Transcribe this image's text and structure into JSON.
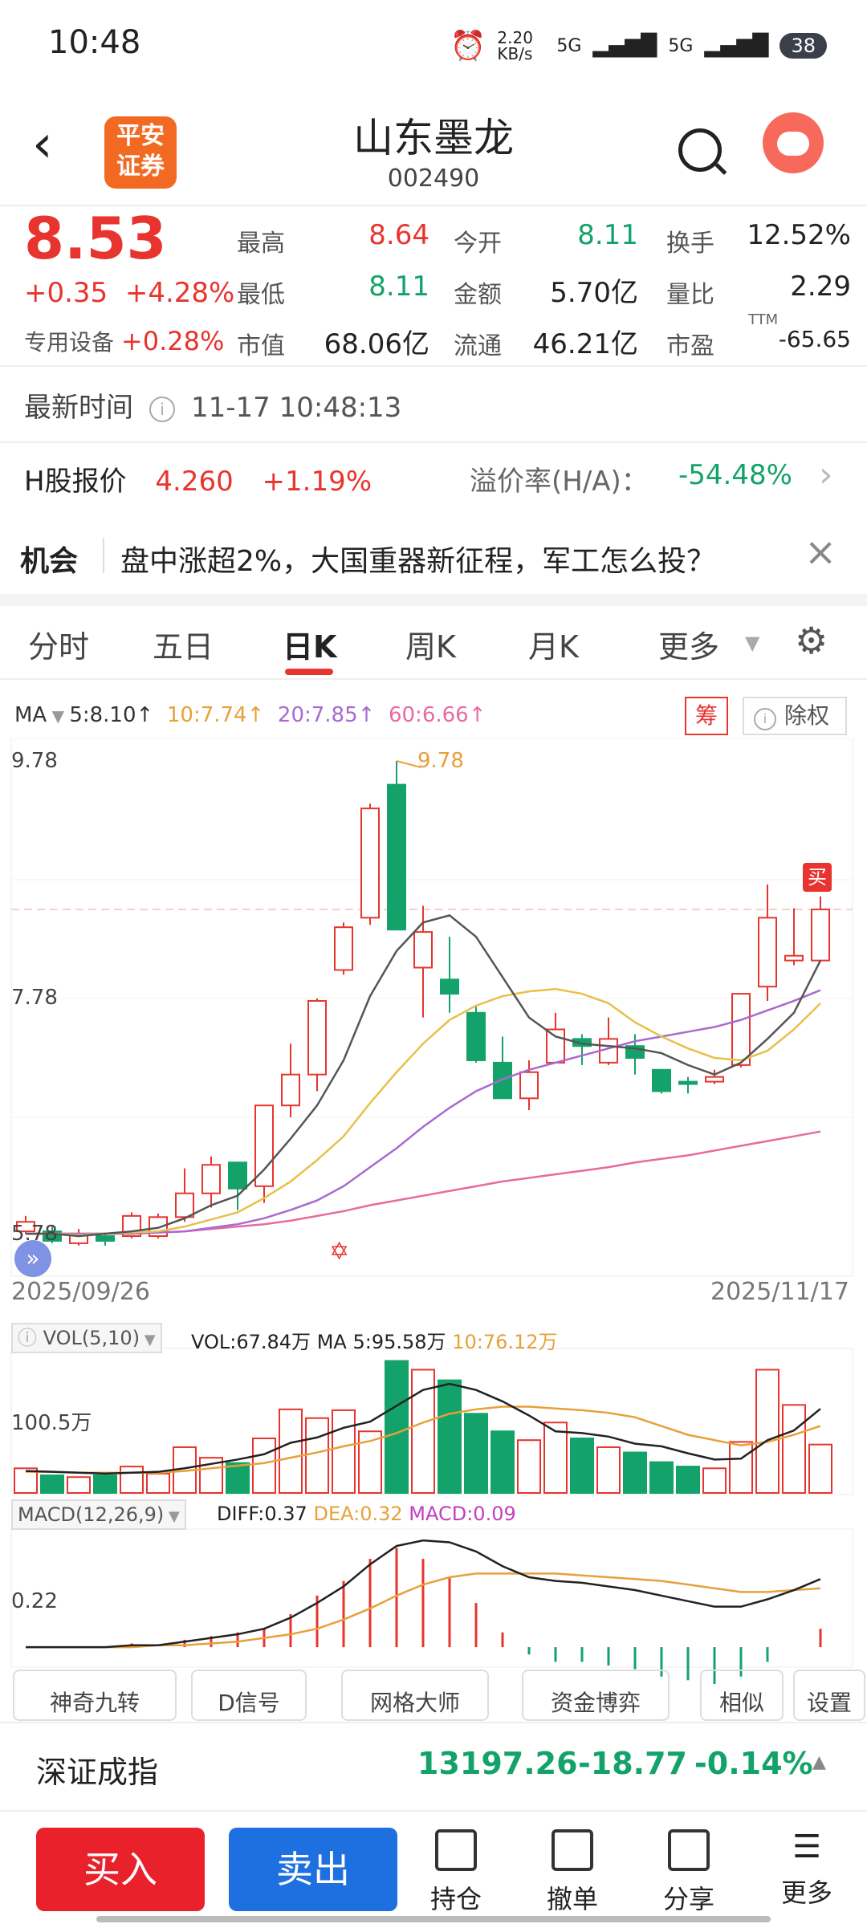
{
  "status": {
    "time": "10:48",
    "speed": "2.20 KB/s",
    "net1": "5G",
    "net2": "5G",
    "battery": "38"
  },
  "header": {
    "logo_text": "平安证券",
    "stock_name": "山东墨龙",
    "stock_code": "002490"
  },
  "quote": {
    "price": "8.53",
    "change": "+0.35",
    "change_pct": "+4.28%",
    "sector_label": "专用设备",
    "sector_pct": "+0.28%",
    "high_label": "最高",
    "high": "8.64",
    "open_label": "今开",
    "open": "8.11",
    "turnover_label": "换手",
    "turnover": "12.52%",
    "low_label": "最低",
    "low": "8.11",
    "amount_label": "金额",
    "amount": "5.70亿",
    "volratio_label": "量比",
    "volratio": "2.29",
    "mcap_label": "市值",
    "mcap": "68.06亿",
    "float_label": "流通",
    "float": "46.21亿",
    "pe_label": "市盈",
    "pe_sup": "TTM",
    "pe": "-65.65"
  },
  "latest": {
    "label": "最新时间",
    "time": "11-17 10:48:13"
  },
  "hshare": {
    "label": "H股报价",
    "price": "4.260",
    "pct": "+1.19%",
    "premium_label": "溢价率(H/A)：",
    "premium": "-54.48%"
  },
  "chance": {
    "tag": "机会",
    "text": "盘中涨超2%，大国重器新征程，军工怎么投？"
  },
  "tabs": [
    "分时",
    "五日",
    "日K",
    "周K",
    "月K",
    "更多"
  ],
  "ma_legend": {
    "ma": "MA",
    "ma5": "5:8.10↑",
    "ma10": "10:7.74↑",
    "ma20": "20:7.85↑",
    "ma60": "60:6.66↑",
    "chip": "筹",
    "fq": "除权"
  },
  "vol_legend": {
    "name": "VOL(5,10)",
    "vol": "VOL:67.84万",
    "ma5": "MA 5:95.58万",
    "ma10": "10:76.12万",
    "level": "100.5万"
  },
  "macd_legend": {
    "name": "MACD(12,26,9)",
    "diff": "DIFF:0.37",
    "dea": "DEA:0.32",
    "macd": "MACD:0.09",
    "level": "0.22"
  },
  "tools": [
    "神奇九转",
    "D信号",
    "网格大师",
    "资金博弈",
    "相似",
    "设置"
  ],
  "index": {
    "name": "深证成指",
    "value": "13197.26",
    "change": "-18.77",
    "pct": "-0.14%"
  },
  "actions": {
    "buy": "买入",
    "sell": "卖出",
    "hold": "持仓",
    "cancel": "撤单",
    "share": "分享",
    "more": "更多"
  },
  "chart_data": {
    "type": "candlestick",
    "start_date": "2025/09/26",
    "end_date": "2025/11/17",
    "ylim": [
      5.78,
      9.78
    ],
    "y_ticks": [
      "9.78",
      "7.78",
      "5.78"
    ],
    "max_label": "9.78",
    "buy_marker": "买",
    "candles": [
      {
        "o": 5.82,
        "c": 5.9,
        "h": 5.95,
        "l": 5.8
      },
      {
        "o": 5.82,
        "c": 5.74,
        "h": 5.86,
        "l": 5.72
      },
      {
        "o": 5.72,
        "c": 5.8,
        "h": 5.84,
        "l": 5.7
      },
      {
        "o": 5.78,
        "c": 5.74,
        "h": 5.8,
        "l": 5.7
      },
      {
        "o": 5.78,
        "c": 5.95,
        "h": 5.98,
        "l": 5.76
      },
      {
        "o": 5.78,
        "c": 5.94,
        "h": 5.97,
        "l": 5.76
      },
      {
        "o": 5.94,
        "c": 6.14,
        "h": 6.35,
        "l": 5.9
      },
      {
        "o": 6.14,
        "c": 6.38,
        "h": 6.45,
        "l": 6.02
      },
      {
        "o": 6.4,
        "c": 6.18,
        "h": 6.4,
        "l": 6.0
      },
      {
        "o": 6.2,
        "c": 6.88,
        "h": 6.88,
        "l": 6.06
      },
      {
        "o": 6.88,
        "c": 7.14,
        "h": 7.4,
        "l": 6.78
      },
      {
        "o": 7.14,
        "c": 7.76,
        "h": 7.78,
        "l": 7.0
      },
      {
        "o": 8.02,
        "c": 8.38,
        "h": 8.42,
        "l": 7.98
      },
      {
        "o": 8.46,
        "c": 9.38,
        "h": 9.42,
        "l": 8.4
      },
      {
        "o": 9.58,
        "c": 8.36,
        "h": 9.78,
        "l": 8.36
      },
      {
        "o": 8.04,
        "c": 8.34,
        "h": 8.56,
        "l": 7.62
      },
      {
        "o": 7.94,
        "c": 7.82,
        "h": 8.3,
        "l": 7.66
      },
      {
        "o": 7.66,
        "c": 7.26,
        "h": 7.72,
        "l": 7.24
      },
      {
        "o": 7.24,
        "c": 6.94,
        "h": 7.46,
        "l": 6.94
      },
      {
        "o": 6.94,
        "c": 7.16,
        "h": 7.26,
        "l": 6.84
      },
      {
        "o": 7.24,
        "c": 7.52,
        "h": 7.66,
        "l": 7.24
      },
      {
        "o": 7.44,
        "c": 7.38,
        "h": 7.48,
        "l": 7.22
      },
      {
        "o": 7.24,
        "c": 7.44,
        "h": 7.62,
        "l": 7.22
      },
      {
        "o": 7.38,
        "c": 7.28,
        "h": 7.48,
        "l": 7.14
      },
      {
        "o": 7.18,
        "c": 7.0,
        "h": 7.18,
        "l": 6.98
      },
      {
        "o": 7.08,
        "c": 7.06,
        "h": 7.12,
        "l": 6.98
      },
      {
        "o": 7.08,
        "c": 7.12,
        "h": 7.18,
        "l": 7.06
      },
      {
        "o": 7.22,
        "c": 7.82,
        "h": 7.82,
        "l": 7.2
      },
      {
        "o": 7.88,
        "c": 8.46,
        "h": 8.74,
        "l": 7.76
      },
      {
        "o": 8.1,
        "c": 8.14,
        "h": 8.54,
        "l": 8.06
      },
      {
        "o": 8.1,
        "c": 8.53,
        "h": 8.64,
        "l": 8.11
      }
    ],
    "ma5": [
      5.8,
      5.8,
      5.78,
      5.8,
      5.82,
      5.85,
      5.93,
      6.04,
      6.12,
      6.34,
      6.6,
      6.88,
      7.26,
      7.8,
      8.18,
      8.42,
      8.48,
      8.3,
      7.96,
      7.62,
      7.46,
      7.4,
      7.38,
      7.36,
      7.32,
      7.22,
      7.14,
      7.24,
      7.44,
      7.66,
      8.1
    ],
    "ma10": [
      5.8,
      5.8,
      5.79,
      5.8,
      5.81,
      5.82,
      5.86,
      5.92,
      5.98,
      6.1,
      6.24,
      6.42,
      6.62,
      6.9,
      7.16,
      7.4,
      7.6,
      7.72,
      7.8,
      7.84,
      7.86,
      7.82,
      7.74,
      7.58,
      7.46,
      7.36,
      7.28,
      7.26,
      7.34,
      7.52,
      7.74
    ],
    "ma20": [
      5.8,
      5.8,
      5.8,
      5.8,
      5.8,
      5.81,
      5.82,
      5.85,
      5.88,
      5.93,
      6.0,
      6.08,
      6.2,
      6.36,
      6.52,
      6.7,
      6.86,
      7.0,
      7.1,
      7.18,
      7.24,
      7.3,
      7.36,
      7.42,
      7.46,
      7.5,
      7.54,
      7.6,
      7.68,
      7.76,
      7.85
    ],
    "ma60": [
      5.8,
      5.8,
      5.8,
      5.8,
      5.8,
      5.81,
      5.82,
      5.84,
      5.86,
      5.88,
      5.91,
      5.95,
      5.99,
      6.04,
      6.08,
      6.12,
      6.16,
      6.2,
      6.24,
      6.27,
      6.3,
      6.33,
      6.36,
      6.4,
      6.43,
      6.46,
      6.5,
      6.54,
      6.58,
      6.62,
      6.66
    ],
    "volume": [
      28,
      20,
      18,
      20,
      30,
      22,
      52,
      40,
      34,
      62,
      95,
      85,
      94,
      70,
      150,
      140,
      128,
      90,
      70,
      60,
      80,
      62,
      52,
      46,
      35,
      30,
      28,
      58,
      140,
      100,
      55
    ],
    "vol_ma5": [
      25,
      24,
      23,
      22,
      23,
      24,
      28,
      33,
      38,
      44,
      57,
      63,
      74,
      81,
      99,
      117,
      124,
      117,
      104,
      88,
      70,
      68,
      64,
      56,
      53,
      45,
      38,
      39,
      60,
      71,
      95.58
    ],
    "vol_ma10": [
      24,
      24,
      23,
      23,
      23,
      23,
      25,
      28,
      31,
      34,
      40,
      46,
      53,
      59,
      68,
      80,
      90,
      95,
      98,
      98,
      96,
      94,
      91,
      86,
      76,
      66,
      60,
      54,
      58,
      66,
      76.12
    ],
    "diff": [
      0.0,
      0.0,
      0.0,
      0.0,
      0.01,
      0.01,
      0.03,
      0.05,
      0.07,
      0.1,
      0.16,
      0.24,
      0.33,
      0.45,
      0.55,
      0.58,
      0.57,
      0.52,
      0.44,
      0.38,
      0.36,
      0.35,
      0.33,
      0.31,
      0.28,
      0.25,
      0.22,
      0.22,
      0.26,
      0.31,
      0.37
    ],
    "dea": [
      0.0,
      0.0,
      0.0,
      0.0,
      0.0,
      0.01,
      0.01,
      0.02,
      0.03,
      0.05,
      0.07,
      0.1,
      0.15,
      0.21,
      0.28,
      0.34,
      0.38,
      0.4,
      0.4,
      0.4,
      0.4,
      0.39,
      0.38,
      0.37,
      0.36,
      0.34,
      0.32,
      0.3,
      0.3,
      0.31,
      0.32
    ]
  }
}
